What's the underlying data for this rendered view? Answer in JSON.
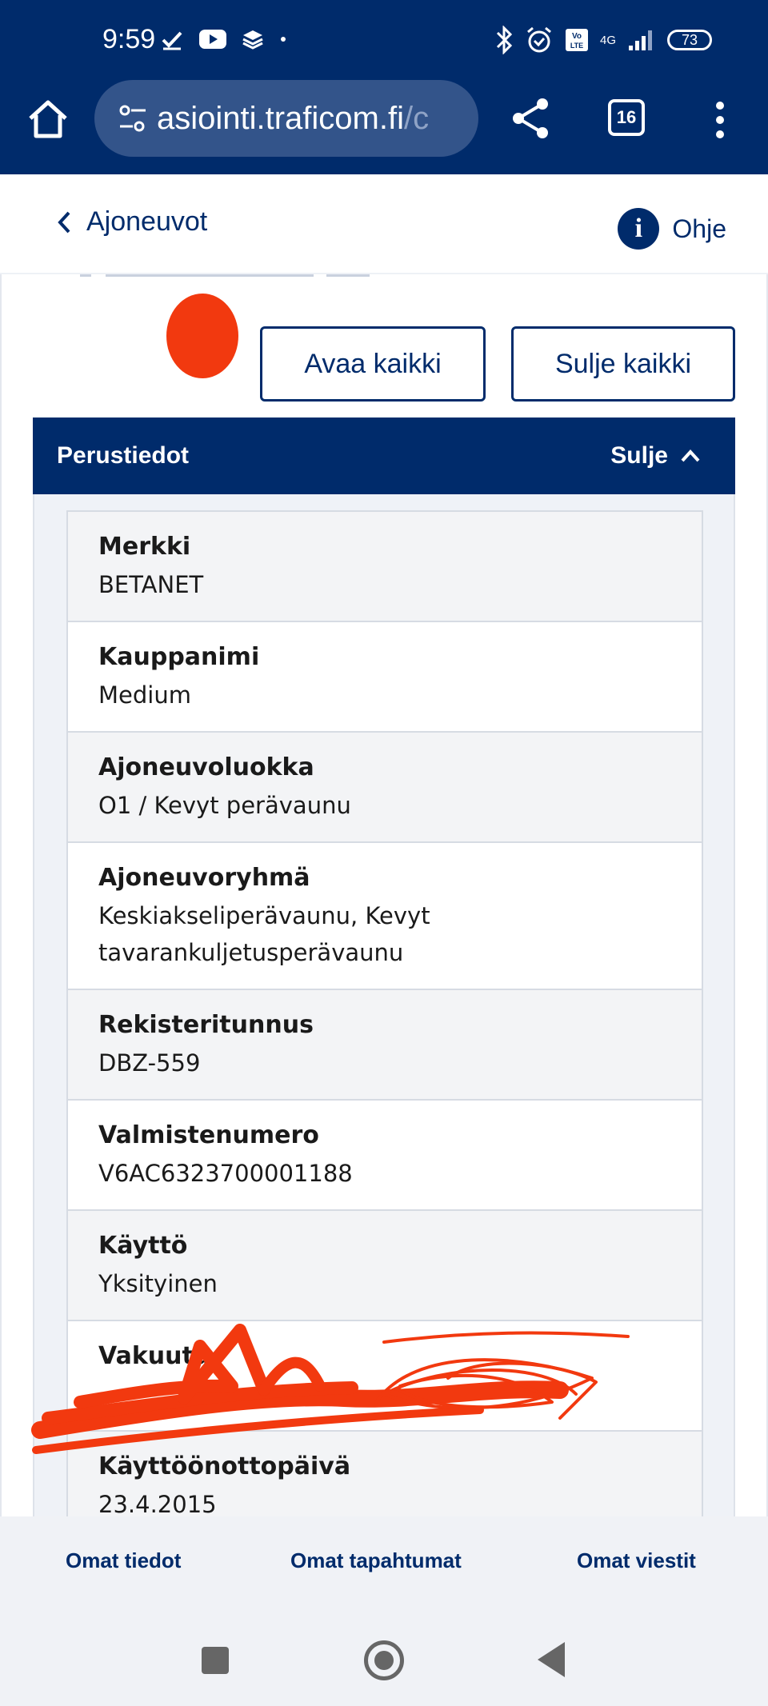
{
  "status_bar": {
    "time": "9:59",
    "battery": "73",
    "network": "4G"
  },
  "browser": {
    "url_main": "asiointi.traficom.fi",
    "url_dim": "/c",
    "tab_count": "16"
  },
  "header": {
    "back_label": "Ajoneuvot",
    "help_label": "Ohje"
  },
  "actions": {
    "open_all": "Avaa kaikki",
    "close_all": "Sulje kaikki"
  },
  "section": {
    "title": "Perustiedot",
    "toggle_label": "Sulje",
    "fields": [
      {
        "label": "Merkki",
        "value": "BETANET"
      },
      {
        "label": "Kauppanimi",
        "value": "Medium"
      },
      {
        "label": "Ajoneuvoluokka",
        "value": "O1 / Kevyt perävaunu"
      },
      {
        "label": "Ajoneuvoryhmä",
        "value": "Keskiakseliperävaunu, Kevyt tavarankuljetusperävaunu"
      },
      {
        "label": "Rekisteritunnus",
        "value": "DBZ-559"
      },
      {
        "label": "Valmistenumero",
        "value": "V6AC6323700001188"
      },
      {
        "label": "Käyttö",
        "value": "Yksityinen"
      },
      {
        "label": "Vakuutu",
        "value": ""
      },
      {
        "label": "Käyttöönottopäivä",
        "value": "23.4.2015"
      }
    ]
  },
  "bottom_nav": {
    "item1": "Omat tiedot",
    "item2": "Omat tapahtumat",
    "item3": "Omat viestit"
  },
  "colors": {
    "brand": "#002b6b",
    "annotation_red": "#f2390f"
  }
}
